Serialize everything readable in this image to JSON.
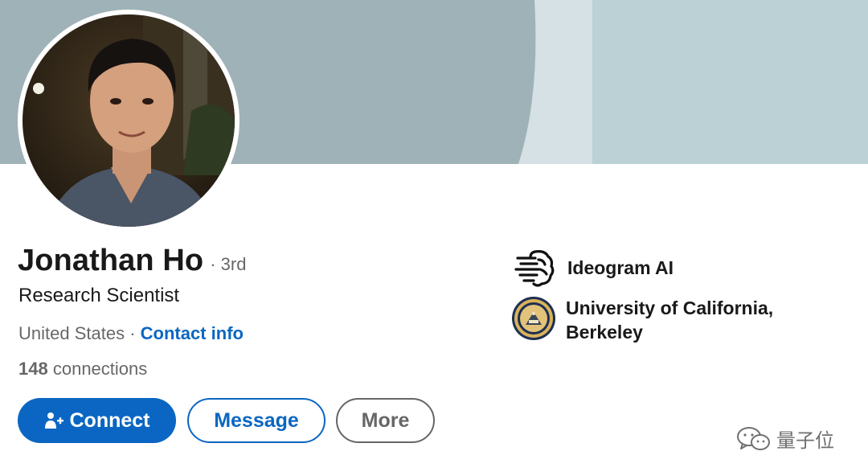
{
  "profile": {
    "name": "Jonathan Ho",
    "degree": "· 3rd",
    "headline": "Research Scientist",
    "location": "United States ·",
    "contact_info": "Contact info",
    "connections_count": "148",
    "connections_label": "connections"
  },
  "actions": {
    "connect": "Connect",
    "message": "Message",
    "more": "More"
  },
  "affiliations": [
    {
      "name": "Ideogram AI",
      "icon": "brain-circuit-logo"
    },
    {
      "name_line1": "University of California,",
      "name_line2": "Berkeley",
      "icon": "uc-berkeley-seal"
    }
  ],
  "watermark": {
    "text": "量子位",
    "icon": "wechat-icon"
  },
  "colors": {
    "accent": "#0a66c2",
    "banner_main": "#9fb2b7",
    "banner_light": "#d5e1e4",
    "banner_right": "#bcd1d6"
  }
}
